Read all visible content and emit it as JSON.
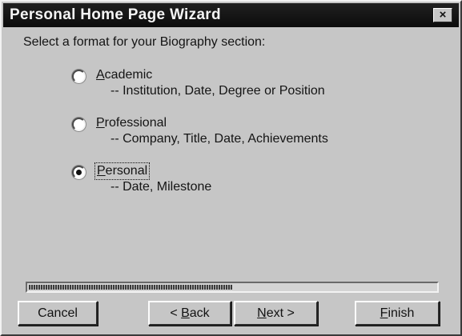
{
  "window": {
    "title": "Personal Home Page Wizard",
    "close_glyph": "×"
  },
  "prompt": "Select a format for your Biography section:",
  "options": [
    {
      "mnemonic": "A",
      "label_rest": "cademic",
      "description": "-- Institution, Date, Degree or Position",
      "selected": false
    },
    {
      "mnemonic": "P",
      "label_rest": "rofessional",
      "description": "-- Company, Title, Date, Achievements",
      "selected": false
    },
    {
      "mnemonic": "P",
      "label_rest": "ersonal",
      "description": "-- Date, Milestone",
      "selected": true
    }
  ],
  "progress": {
    "fraction": 0.5
  },
  "buttons": {
    "cancel": "Cancel",
    "back_prefix": "< ",
    "back_mnemonic": "B",
    "back_rest": "ack",
    "next_mnemonic": "N",
    "next_rest": "ext >",
    "finish_mnemonic": "F",
    "finish_rest": "inish"
  }
}
